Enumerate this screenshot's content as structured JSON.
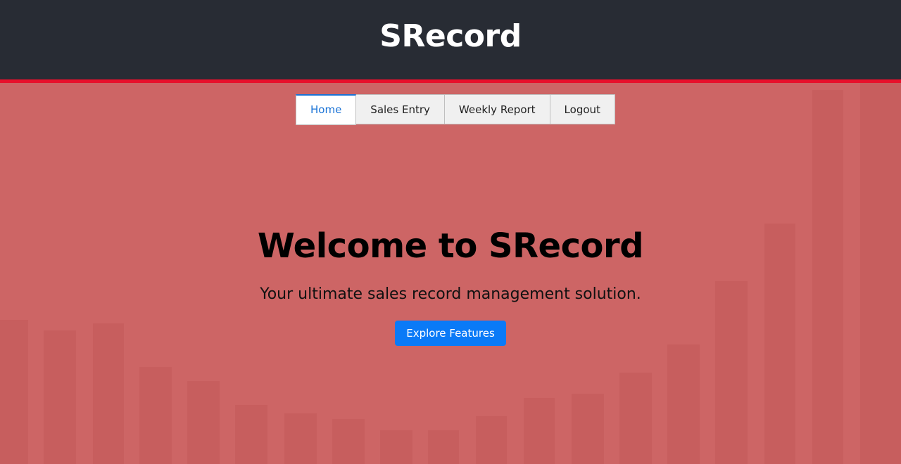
{
  "header": {
    "brand": "SRecord"
  },
  "nav": {
    "tabs": [
      {
        "label": "Home",
        "active": true
      },
      {
        "label": "Sales Entry",
        "active": false
      },
      {
        "label": "Weekly Report",
        "active": false
      },
      {
        "label": "Logout",
        "active": false
      }
    ]
  },
  "hero": {
    "title": "Welcome to SRecord",
    "subtitle": "Your ultimate sales record management solution.",
    "cta_label": "Explore Features"
  },
  "colors": {
    "header_bg": "#282c34",
    "header_accent": "#e8102b",
    "page_bg": "#cd6565",
    "primary": "#0a7af7",
    "active_tab": "#1a73d6"
  }
}
